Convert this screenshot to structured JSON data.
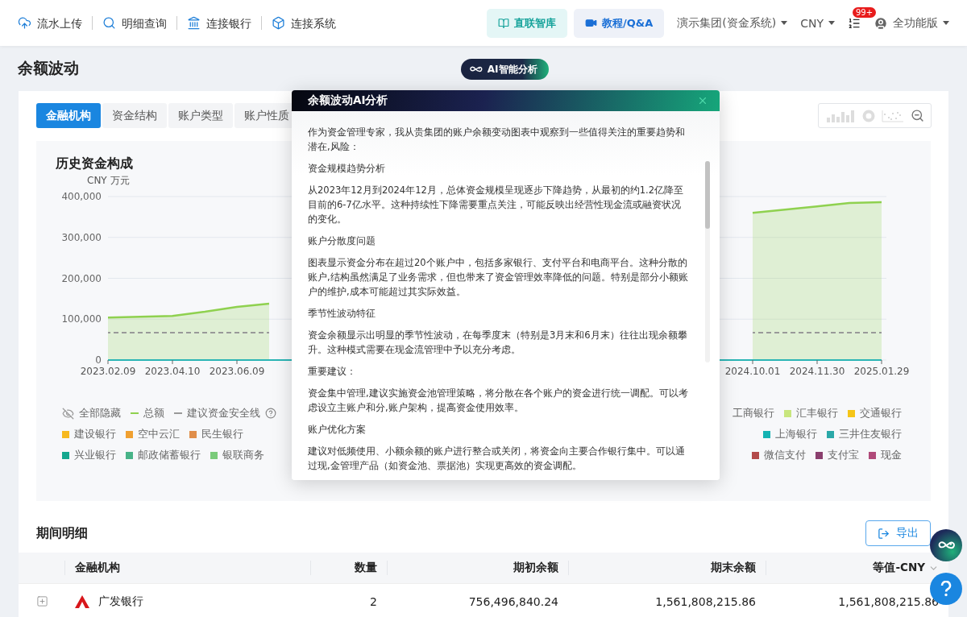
{
  "topnav": {
    "links": [
      {
        "label": "流水上传"
      },
      {
        "label": "明细查询"
      },
      {
        "label": "连接银行"
      },
      {
        "label": "连接系统"
      }
    ],
    "library_button": "直联智库",
    "tutorial_button": "教程/Q&A",
    "org_select": "演示集团(资金系统)",
    "currency_select": "CNY",
    "notifications_badge": "99+",
    "user_menu": "全功能版"
  },
  "page_title": "余额波动",
  "ai_button": "AI智能分析",
  "tabs": [
    {
      "label": "金融机构",
      "selected": true
    },
    {
      "label": "资金结构",
      "selected": false
    },
    {
      "label": "账户类型",
      "selected": false
    },
    {
      "label": "账户性质",
      "selected": false
    }
  ],
  "chart_panel": {
    "title": "历史资金构成",
    "chart_data": {
      "type": "line",
      "ylabel": "CNY 万元",
      "ylim": [
        0,
        400000
      ],
      "yticks": [
        {
          "value": 0,
          "label": "0"
        },
        {
          "value": 100000,
          "label": "100,000"
        },
        {
          "value": 200000,
          "label": "200,000"
        },
        {
          "value": 300000,
          "label": "300,000"
        },
        {
          "value": 400000,
          "label": "400,000"
        }
      ],
      "grid": true,
      "categories": [
        "2023.02.09",
        null,
        "2023.04.10",
        null,
        "2023.06.09",
        null,
        null,
        null,
        null,
        null,
        null,
        null,
        null,
        null,
        null,
        null,
        null,
        null,
        null,
        null,
        "2024.10.01",
        null,
        "2024.11.30",
        null,
        "2025.01.29"
      ],
      "series": [
        {
          "name": "总额",
          "color": "#8fd14f",
          "line_style": "solid",
          "values": [
            104000,
            106000,
            108000,
            118000,
            130000,
            138000,
            null,
            null,
            null,
            null,
            null,
            null,
            null,
            null,
            null,
            null,
            null,
            null,
            null,
            null,
            360000,
            368000,
            376000,
            384000,
            386000
          ]
        },
        {
          "name": "建议资金安全线",
          "color": "#999999",
          "line_style": "dashed",
          "values": [
            67000,
            67000,
            67000,
            67000,
            67000,
            67000,
            null,
            null,
            null,
            null,
            null,
            null,
            null,
            null,
            null,
            null,
            null,
            null,
            null,
            null,
            67000,
            67000,
            67000,
            67000,
            67000
          ]
        }
      ]
    },
    "legend": [
      {
        "left": [
          {
            "kind": "eye",
            "label": "全部隐藏"
          }
        ],
        "right": [
          {
            "kind": "text",
            "label": "工商银行"
          },
          {
            "kind": "square",
            "label": "汇丰银行",
            "color": "#c8e67e"
          },
          {
            "kind": "square",
            "label": "交通银行",
            "color": "#f5c518"
          }
        ]
      },
      {
        "left": [
          {
            "kind": "square",
            "label": "建设银行",
            "color": "#f7b91f"
          },
          {
            "kind": "square",
            "label": "空中云汇",
            "color": "#f0a030"
          },
          {
            "kind": "square",
            "label": "民生银行",
            "color": "#e08e4a"
          }
        ],
        "right": [
          {
            "kind": "square",
            "label": "上海银行",
            "color": "#14b3b3"
          },
          {
            "kind": "square",
            "label": "三井住友银行",
            "color": "#2aa8a8"
          }
        ]
      },
      {
        "left": [
          {
            "kind": "square",
            "label": "兴业银行",
            "color": "#14a88f"
          },
          {
            "kind": "square",
            "label": "邮政储蓄银行",
            "color": "#48b388"
          },
          {
            "kind": "square",
            "label": "银联商务",
            "color": "#7acb7a"
          }
        ],
        "right": [
          {
            "kind": "square",
            "label": "微信支付",
            "color": "#b34a4a"
          },
          {
            "kind": "square",
            "label": "支付宝",
            "color": "#8a3f6e"
          },
          {
            "kind": "square",
            "label": "现金",
            "color": "#b04a7a"
          }
        ]
      }
    ]
  },
  "details": {
    "title": "期间明细",
    "export_button": "导出",
    "columns": [
      "金融机构",
      "数量",
      "期初余额",
      "期末余额",
      "等值-CNY"
    ],
    "rows": [
      {
        "cells": [
          "广发银行",
          "2",
          "756,496,840.24",
          "1,561,808,215.86",
          "1,561,808,215.86"
        ]
      }
    ]
  },
  "modal": {
    "title": "余额波动AI分析",
    "paragraphs": [
      "作为资金管理专家，我从贵集团的账户余额变动图表中观察到一些值得关注的重要趋势和潜在,风险：",
      "资金规模趋势分析",
      "从2023年12月到2024年12月，总体资金规模呈现逐步下降趋势，从最初的约1.2亿降至目前的6-7亿水平。这种持续性下降需要重点关注，可能反映出经营性现金流或融资状况的变化。",
      "账户分散度问题",
      "图表显示资金分布在超过20个账户中，包括多家银行、支付平台和电商平台。这种分散的账户,结构虽然满足了业务需求，但也带来了资金管理效率降低的问题。特别是部分小额账户的维护,成本可能超过其实际效益。",
      "季节性波动特征",
      "资金余额显示出明显的季节性波动，在每季度末（特别是3月末和6月末）往往出现余额攀升。这种模式需要在现金流管理中予以充分考虑。",
      "重要建议：",
      "资金集中管理,建议实施资金池管理策略，将分散在各个账户的资金进行统一调配。可以考虑设立主账户和分,账户架构，提高资金使用效率。",
      "账户优化方案",
      "建议对低频使用、小额余额的账户进行整合或关闭，将资金向主要合作银行集中。可以通过现,金管理产品（如资金池、票据池）实现更高效的资金调配。"
    ]
  }
}
